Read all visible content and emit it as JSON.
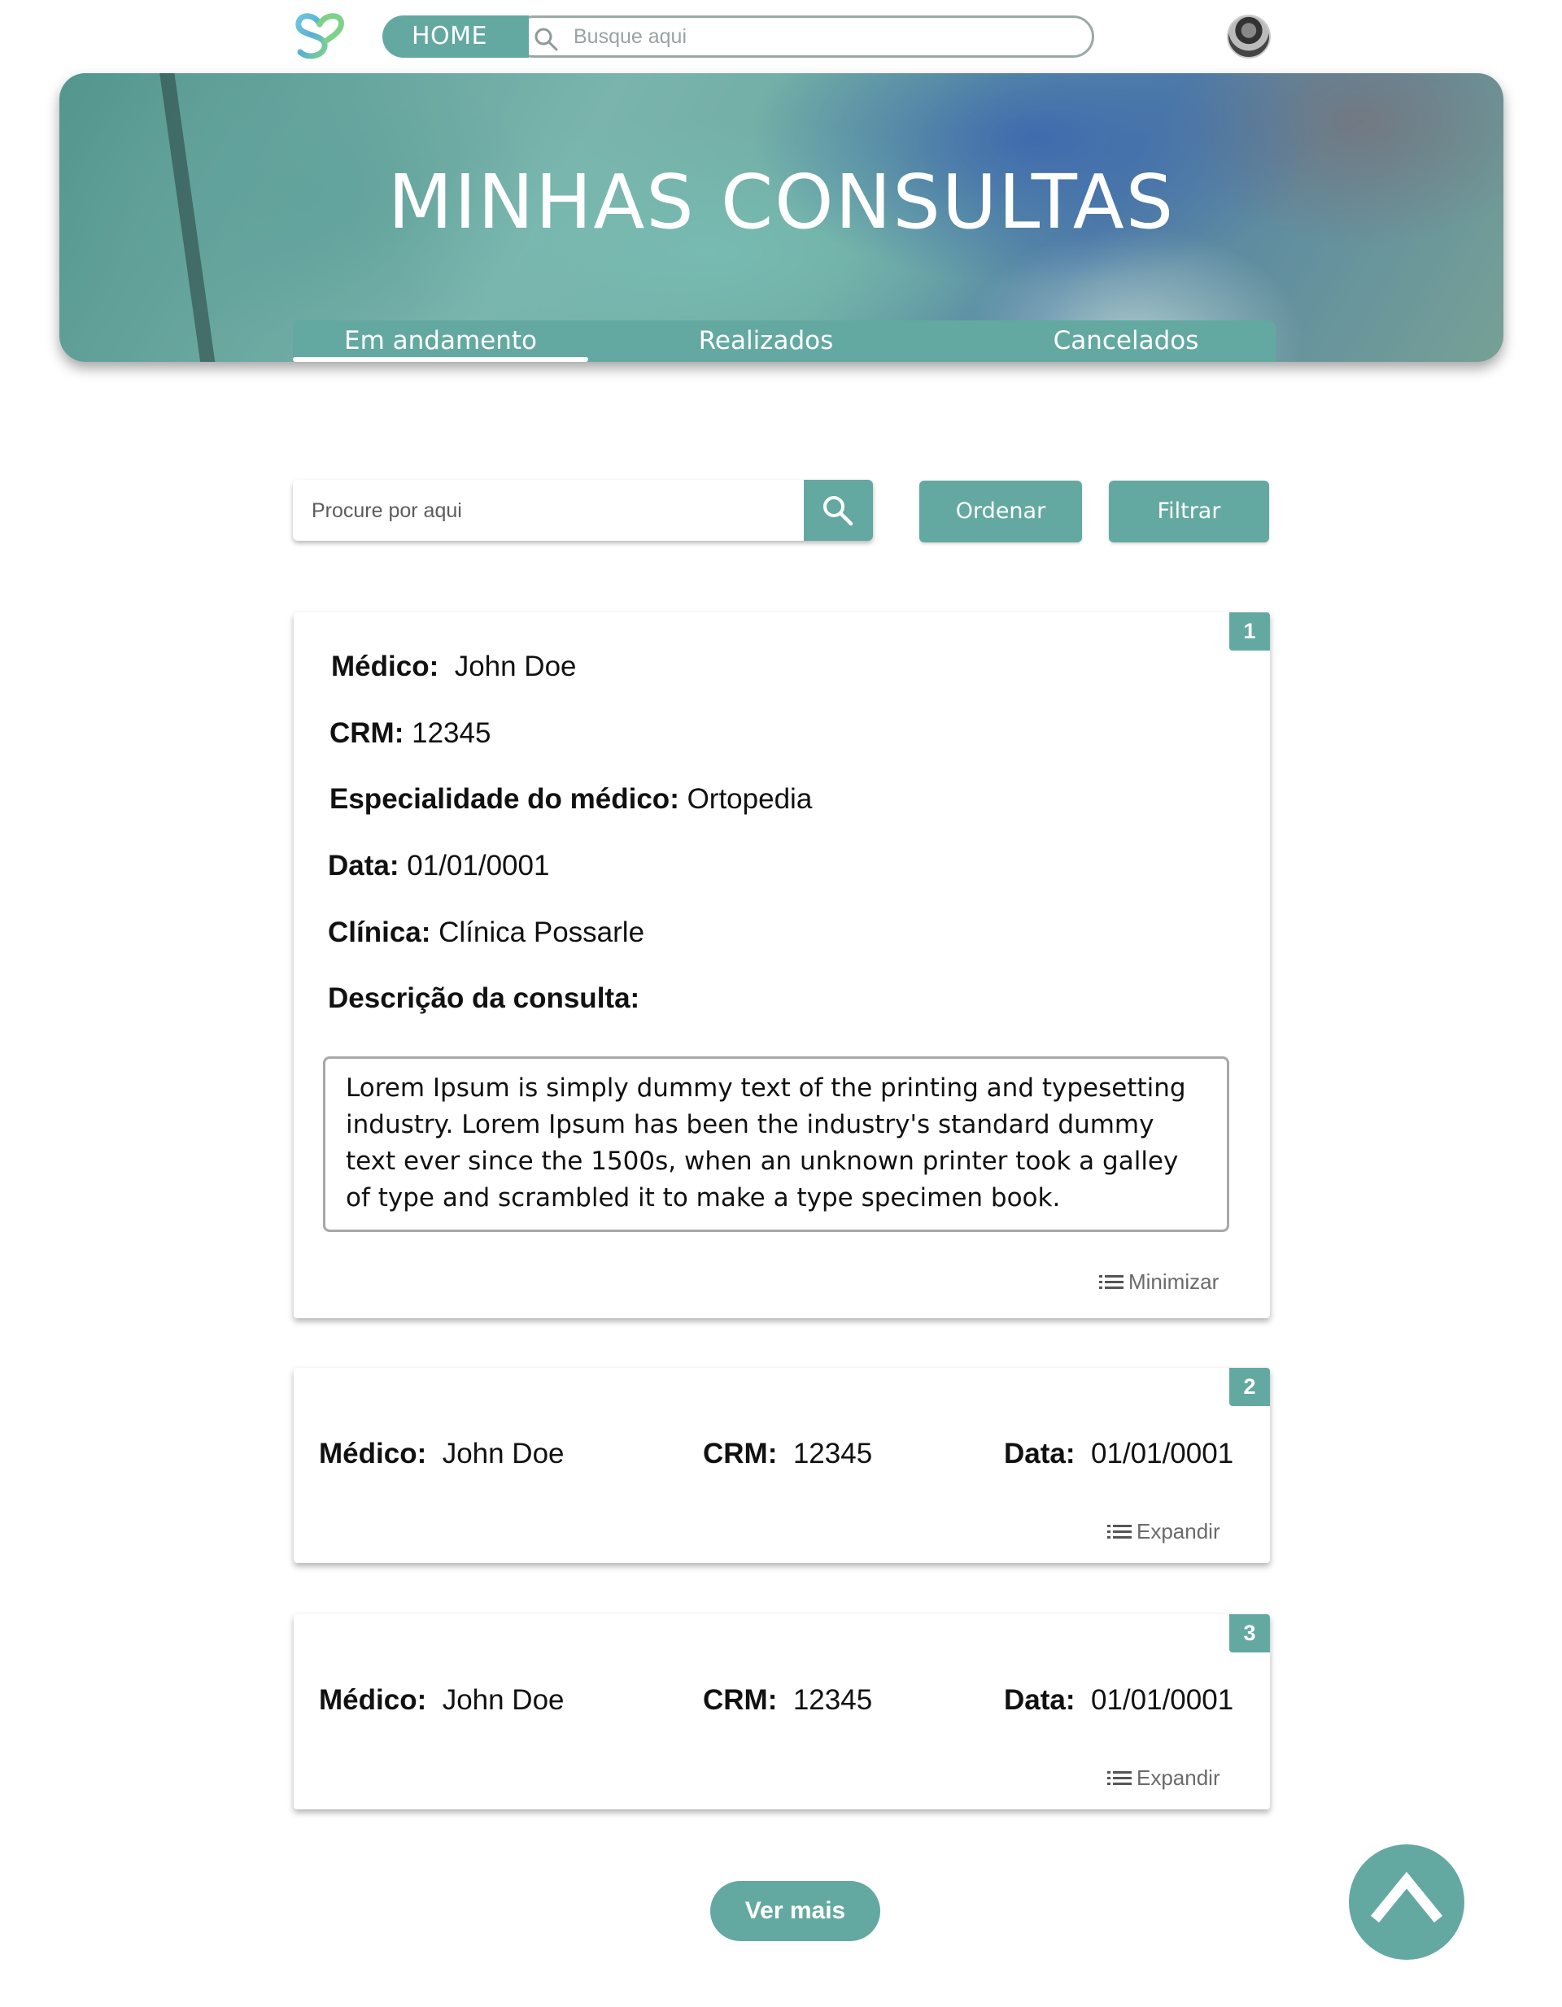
{
  "nav": {
    "home_label": "HOME",
    "search_placeholder": "Busque aqui",
    "icons": {
      "logo": "heart-s-logo",
      "search": "search-icon",
      "avatar": "user-avatar"
    }
  },
  "hero": {
    "title": "MINHAS CONSULTAS",
    "tabs": [
      {
        "label": "Em andamento",
        "active": true
      },
      {
        "label": "Realizados",
        "active": false
      },
      {
        "label": "Cancelados",
        "active": false
      }
    ]
  },
  "toolbar": {
    "search_placeholder": "Procure por aqui",
    "order_label": "Ordenar",
    "filter_label": "Filtrar"
  },
  "cards": [
    {
      "number": "1",
      "doctor_label": "Médico:",
      "doctor": "John Doe",
      "crm_label": "CRM:",
      "crm": "12345",
      "specialty_label": "Especialidade do médico:",
      "specialty": "Ortopedia",
      "date_label": "Data:",
      "date": "01/01/0001",
      "clinic_label": "Clínica:",
      "clinic": "Clínica Possarle",
      "description_label": "Descrição da consulta:",
      "description": "Lorem Ipsum is simply dummy text of the printing and typesetting industry. Lorem Ipsum has been the industry's standard dummy text ever since the 1500s, when an unknown printer took a galley of type and scrambled it to make a type specimen book.",
      "toggle_label": "Minimizar"
    },
    {
      "number": "2",
      "doctor_label": "Médico:",
      "doctor": "John Doe",
      "crm_label": "CRM:",
      "crm": "12345",
      "date_label": "Data:",
      "date": "01/01/0001",
      "toggle_label": "Expandir"
    },
    {
      "number": "3",
      "doctor_label": "Médico:",
      "doctor": "John Doe",
      "crm_label": "CRM:",
      "crm": "12345",
      "date_label": "Data:",
      "date": "01/01/0001",
      "toggle_label": "Expandir"
    }
  ],
  "more_label": "Ver mais",
  "colors": {
    "accent": "#63a9a1"
  }
}
